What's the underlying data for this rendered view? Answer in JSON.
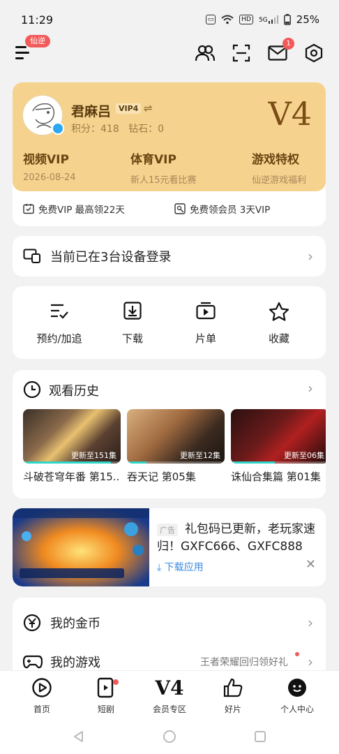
{
  "status_bar": {
    "time": "11:29",
    "hd_label": "HD",
    "five_g_label": "5G",
    "battery": "25%"
  },
  "top_nav": {
    "tag": "仙逆",
    "mail_badge": "1"
  },
  "vip_card": {
    "username": "君麻吕",
    "vip_tag": "VIP4",
    "score_line": "积分：418   钻石：0",
    "level_big": "V4",
    "columns": [
      {
        "title": "视频VIP",
        "sub": "2026-08-24"
      },
      {
        "title": "体育VIP",
        "sub": "新人15元看比赛"
      },
      {
        "title": "游戏特权",
        "sub": "仙逆游戏福利"
      }
    ],
    "bottom_left": "免费VIP 最高领22天",
    "bottom_right": "免费领会员 3天VIP"
  },
  "devices": {
    "label": "当前已在3台设备登录"
  },
  "actions": [
    {
      "label": "预约/加追"
    },
    {
      "label": "下载"
    },
    {
      "label": "片单"
    },
    {
      "label": "收藏"
    }
  ],
  "history": {
    "title": "观看历史",
    "items": [
      {
        "title": "斗破苍穹年番 第15...",
        "caption": "更新至151集",
        "progress": 0.9
      },
      {
        "title": "吞天记 第05集",
        "caption": "更新至12集",
        "progress": 0.2
      },
      {
        "title": "诛仙合集篇 第01集",
        "caption": "更新至06集",
        "progress": 0.45
      }
    ]
  },
  "ad": {
    "tag": "广告",
    "text": "礼包码已更新，老玩家速归！GXFC666、GXFC888",
    "download": "下载应用"
  },
  "menu": [
    {
      "label": "我的金币",
      "extra": ""
    },
    {
      "label": "我的游戏",
      "extra": "王者荣耀回归领好礼"
    }
  ],
  "tabbar": [
    {
      "label": "首页"
    },
    {
      "label": "短剧"
    },
    {
      "label": "会员专区",
      "icon_text": "V4"
    },
    {
      "label": "好片"
    },
    {
      "label": "个人中心"
    }
  ],
  "colors": {
    "gold": "#f5d38e",
    "accent_red": "#f25a5a",
    "link_blue": "#3a8be0",
    "progress": "#2fd6c8"
  }
}
